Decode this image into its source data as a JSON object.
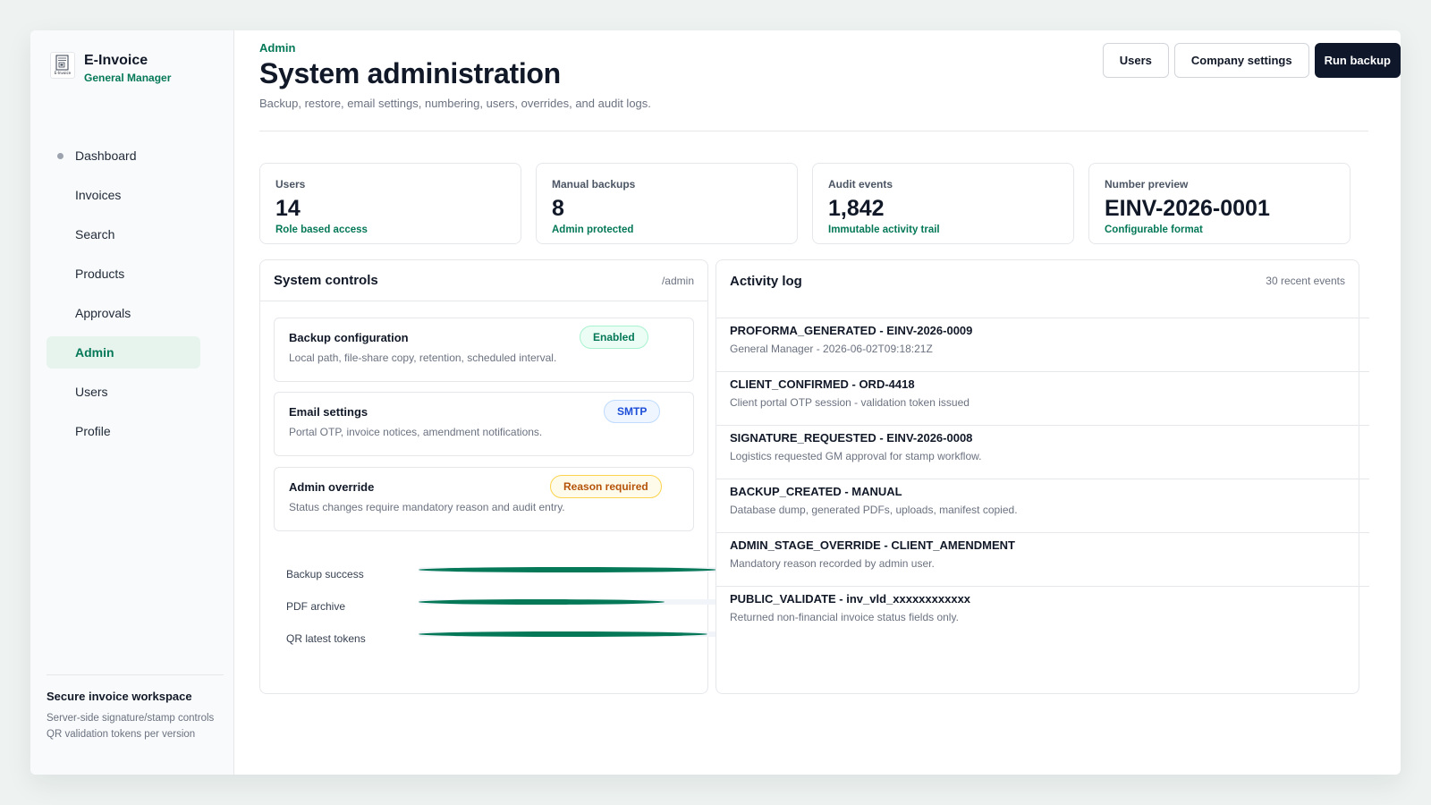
{
  "brand": {
    "title": "E-Invoice",
    "subtitle": "General Manager",
    "logo_text": "E-Invoice"
  },
  "nav": [
    {
      "label": "Dashboard",
      "active": false
    },
    {
      "label": "Invoices",
      "active": false
    },
    {
      "label": "Search",
      "active": false
    },
    {
      "label": "Products",
      "active": false
    },
    {
      "label": "Approvals",
      "active": false
    },
    {
      "label": "Admin",
      "active": true
    },
    {
      "label": "Users",
      "active": false
    },
    {
      "label": "Profile",
      "active": false
    }
  ],
  "sidebar_footer": {
    "title": "Secure invoice workspace",
    "line1": "Server-side signature/stamp controls",
    "line2": "QR validation tokens per version"
  },
  "header": {
    "breadcrumb": "Admin",
    "title": "System administration",
    "description": "Backup, restore, email settings, numbering, users, overrides, and audit logs.",
    "users_button": "Users",
    "company_button": "Company settings",
    "backup_button": "Run backup"
  },
  "stats": [
    {
      "label": "Users",
      "value": "14",
      "note": "Role based access"
    },
    {
      "label": "Manual backups",
      "value": "8",
      "note": "Admin protected"
    },
    {
      "label": "Audit events",
      "value": "1,842",
      "note": "Immutable activity trail"
    },
    {
      "label": "Number preview",
      "value": "EINV-2026-0001",
      "note": "Configurable format"
    }
  ],
  "controls": {
    "title": "System controls",
    "path": "/admin",
    "items": [
      {
        "title": "Backup configuration",
        "description": "Local path, file-share copy, retention, scheduled interval.",
        "badge": "Enabled"
      },
      {
        "title": "Email settings",
        "description": "Portal OTP, invoice notices, amendment notifications.",
        "badge": "SMTP"
      },
      {
        "title": "Admin override",
        "description": "Status changes require mandatory reason and audit entry.",
        "badge": "Reason required"
      }
    ],
    "bars": [
      {
        "label": "Backup success",
        "value": 98
      },
      {
        "label": "PDF archive",
        "value": 81
      },
      {
        "label": "QR latest tokens",
        "value": 95
      }
    ]
  },
  "activity": {
    "title": "Activity log",
    "count": "30 recent events",
    "events": [
      {
        "title": "PROFORMA_GENERATED - EINV-2026-0009",
        "detail": "General Manager - 2026-06-02T09:18:21Z"
      },
      {
        "title": "CLIENT_CONFIRMED - ORD-4418",
        "detail": "Client portal OTP session - validation token issued"
      },
      {
        "title": "SIGNATURE_REQUESTED - EINV-2026-0008",
        "detail": "Logistics requested GM approval for stamp workflow."
      },
      {
        "title": "BACKUP_CREATED - MANUAL",
        "detail": "Database dump, generated PDFs, uploads, manifest copied."
      },
      {
        "title": "ADMIN_STAGE_OVERRIDE - CLIENT_AMENDMENT",
        "detail": "Mandatory reason recorded by admin user."
      },
      {
        "title": "PUBLIC_VALIDATE - inv_vld_xxxxxxxxxxxx",
        "detail": "Returned non-financial invoice status fields only."
      }
    ]
  },
  "colors": {
    "accent": "#047857",
    "primary_button": "#0f172a",
    "active_nav_bg": "#e7f4ee"
  }
}
